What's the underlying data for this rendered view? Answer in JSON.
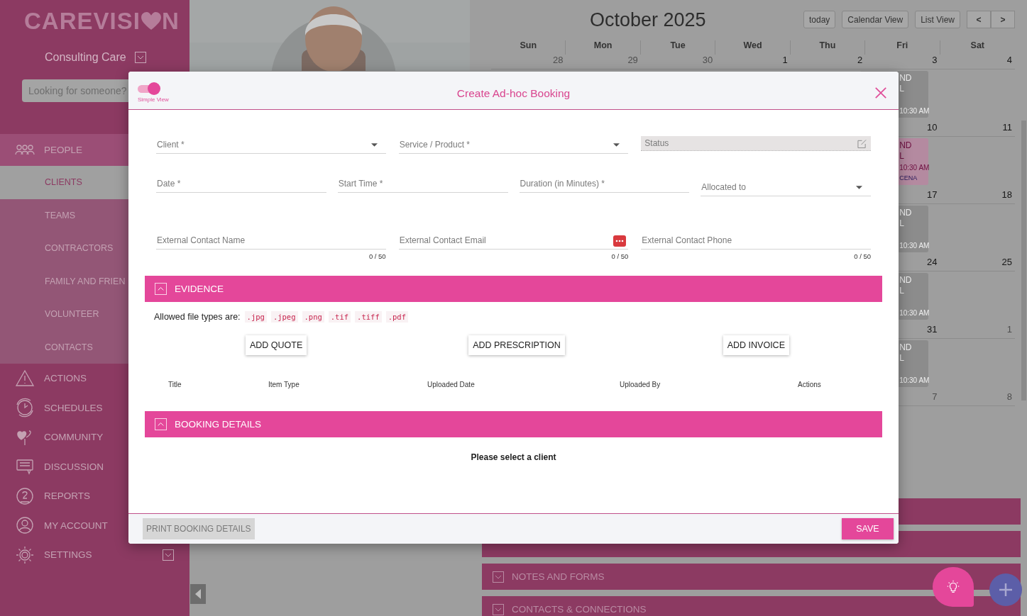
{
  "sidebar": {
    "logo": [
      "CAREVISI",
      "N"
    ],
    "org": "Consulting Care",
    "search": {
      "placeholder": "Looking for someone?"
    },
    "items": [
      {
        "label": "PEOPLE",
        "expanded": true,
        "children": [
          {
            "label": "CLIENTS",
            "selected": true
          },
          {
            "label": "TEAMS",
            "selected": false
          },
          {
            "label": "CONTRACTORS",
            "selected": false
          },
          {
            "label": "FAMILY AND FRIEN",
            "selected": false
          },
          {
            "label": "VOLUNTEER",
            "selected": false
          },
          {
            "label": "CONTACTS",
            "selected": false
          }
        ]
      },
      {
        "label": "ACTIONS"
      },
      {
        "label": "SCHEDULES"
      },
      {
        "label": "COMMUNITY"
      },
      {
        "label": "DISCUSSION"
      },
      {
        "label": "REPORTS"
      },
      {
        "label": "MY ACCOUNT"
      },
      {
        "label": "SETTINGS",
        "expanded": false
      }
    ]
  },
  "calendar": {
    "title": "October 2025",
    "buttons": [
      "today",
      "Calendar View",
      "List View"
    ],
    "prev": "<",
    "next": ">",
    "weekdays": [
      "Sun",
      "Mon",
      "Tue",
      "Wed",
      "Thu",
      "Fri",
      "Sat"
    ],
    "weeks": [
      {
        "days": [
          {
            "label": "28",
            "muted": true
          },
          {
            "label": "29",
            "muted": true
          },
          {
            "label": "30",
            "muted": true
          },
          {
            "label": "1",
            "muted": false
          },
          {
            "label": "2",
            "muted": false
          },
          {
            "label": "3",
            "muted": false
          },
          {
            "label": "4",
            "muted": false
          }
        ],
        "event": {
          "color": "#8c8c8c",
          "lines": [
            "ND",
            "L",
            "10:30 AM"
          ]
        }
      },
      {
        "days": [
          {
            "label": "10",
            "muted": false
          },
          {
            "label": "11",
            "muted": false
          }
        ],
        "event": {
          "color": "#b48aa0",
          "lines": [
            "ND",
            "L",
            "10:30 AM",
            "CENA"
          ]
        }
      },
      {
        "days": [
          {
            "label": "17",
            "muted": false
          },
          {
            "label": "18",
            "muted": false
          }
        ],
        "event": {
          "color": "#8c8c8c",
          "lines": [
            "ND",
            "L",
            "10:30 AM"
          ]
        }
      },
      {
        "days": [
          {
            "label": "24",
            "muted": false
          },
          {
            "label": "25",
            "muted": false
          }
        ],
        "event": {
          "color": "#8c8c8c",
          "lines": [
            "ND",
            "L",
            "10:30 AM"
          ]
        }
      },
      {
        "days": [
          {
            "label": "31",
            "muted": false
          },
          {
            "label": "1",
            "muted": true
          }
        ],
        "event": {
          "color": "#8c8c8c",
          "lines": [
            "ND",
            "L",
            "10:30 AM"
          ]
        }
      },
      {
        "days": [
          {
            "label": "7",
            "muted": true
          },
          {
            "label": "8",
            "muted": true
          }
        ]
      }
    ]
  },
  "sections": [
    {
      "label": "NOTES AND FORMS",
      "expanded": false
    },
    {
      "label": "CONTACTS & CONNECTIONS",
      "expanded": false
    }
  ],
  "modal": {
    "toggle": {
      "label": "Simple View",
      "on": true
    },
    "title": "Create Ad-hoc Booking",
    "rows": [
      [
        {
          "placeholder": "Client *",
          "kind": "select"
        },
        {
          "placeholder": "Service / Product *",
          "kind": "select"
        },
        {
          "placeholder": "Status",
          "kind": "readonly"
        }
      ],
      [
        {
          "placeholder": "Date *",
          "kind": "text"
        },
        {
          "placeholder": "Start Time *",
          "kind": "text"
        },
        {
          "placeholder": "Duration (in Minutes) *",
          "kind": "text"
        },
        {
          "placeholder": "Allocated to",
          "kind": "select"
        }
      ],
      [
        {
          "placeholder": "External Contact Name",
          "kind": "text",
          "counter": "0 / 50"
        },
        {
          "placeholder": "External Contact Email",
          "kind": "email",
          "counter": "0 / 50"
        },
        {
          "placeholder": "External Contact Phone",
          "kind": "text",
          "counter": "0 / 50"
        }
      ]
    ],
    "sections": [
      {
        "title": "EVIDENCE",
        "expanded": true,
        "kind": "evidence",
        "allowed_label": "Allowed file types are:",
        "file_types": [
          ".jpg",
          ".jpeg",
          ".png",
          ".tif",
          ".tiff",
          ".pdf"
        ],
        "buttons": [
          "ADD QUOTE",
          "ADD PRESCRIPTION",
          "ADD INVOICE"
        ],
        "columns": [
          "Title",
          "Item Type",
          "Uploaded Date",
          "Uploaded By",
          "Actions"
        ]
      },
      {
        "title": "BOOKING DETAILS",
        "expanded": true,
        "kind": "message",
        "message": "Please select a client"
      }
    ],
    "footer": {
      "print_button": {
        "label": "PRINT BOOKING DETAILS",
        "disabled": true
      },
      "save_button": "SAVE"
    }
  }
}
